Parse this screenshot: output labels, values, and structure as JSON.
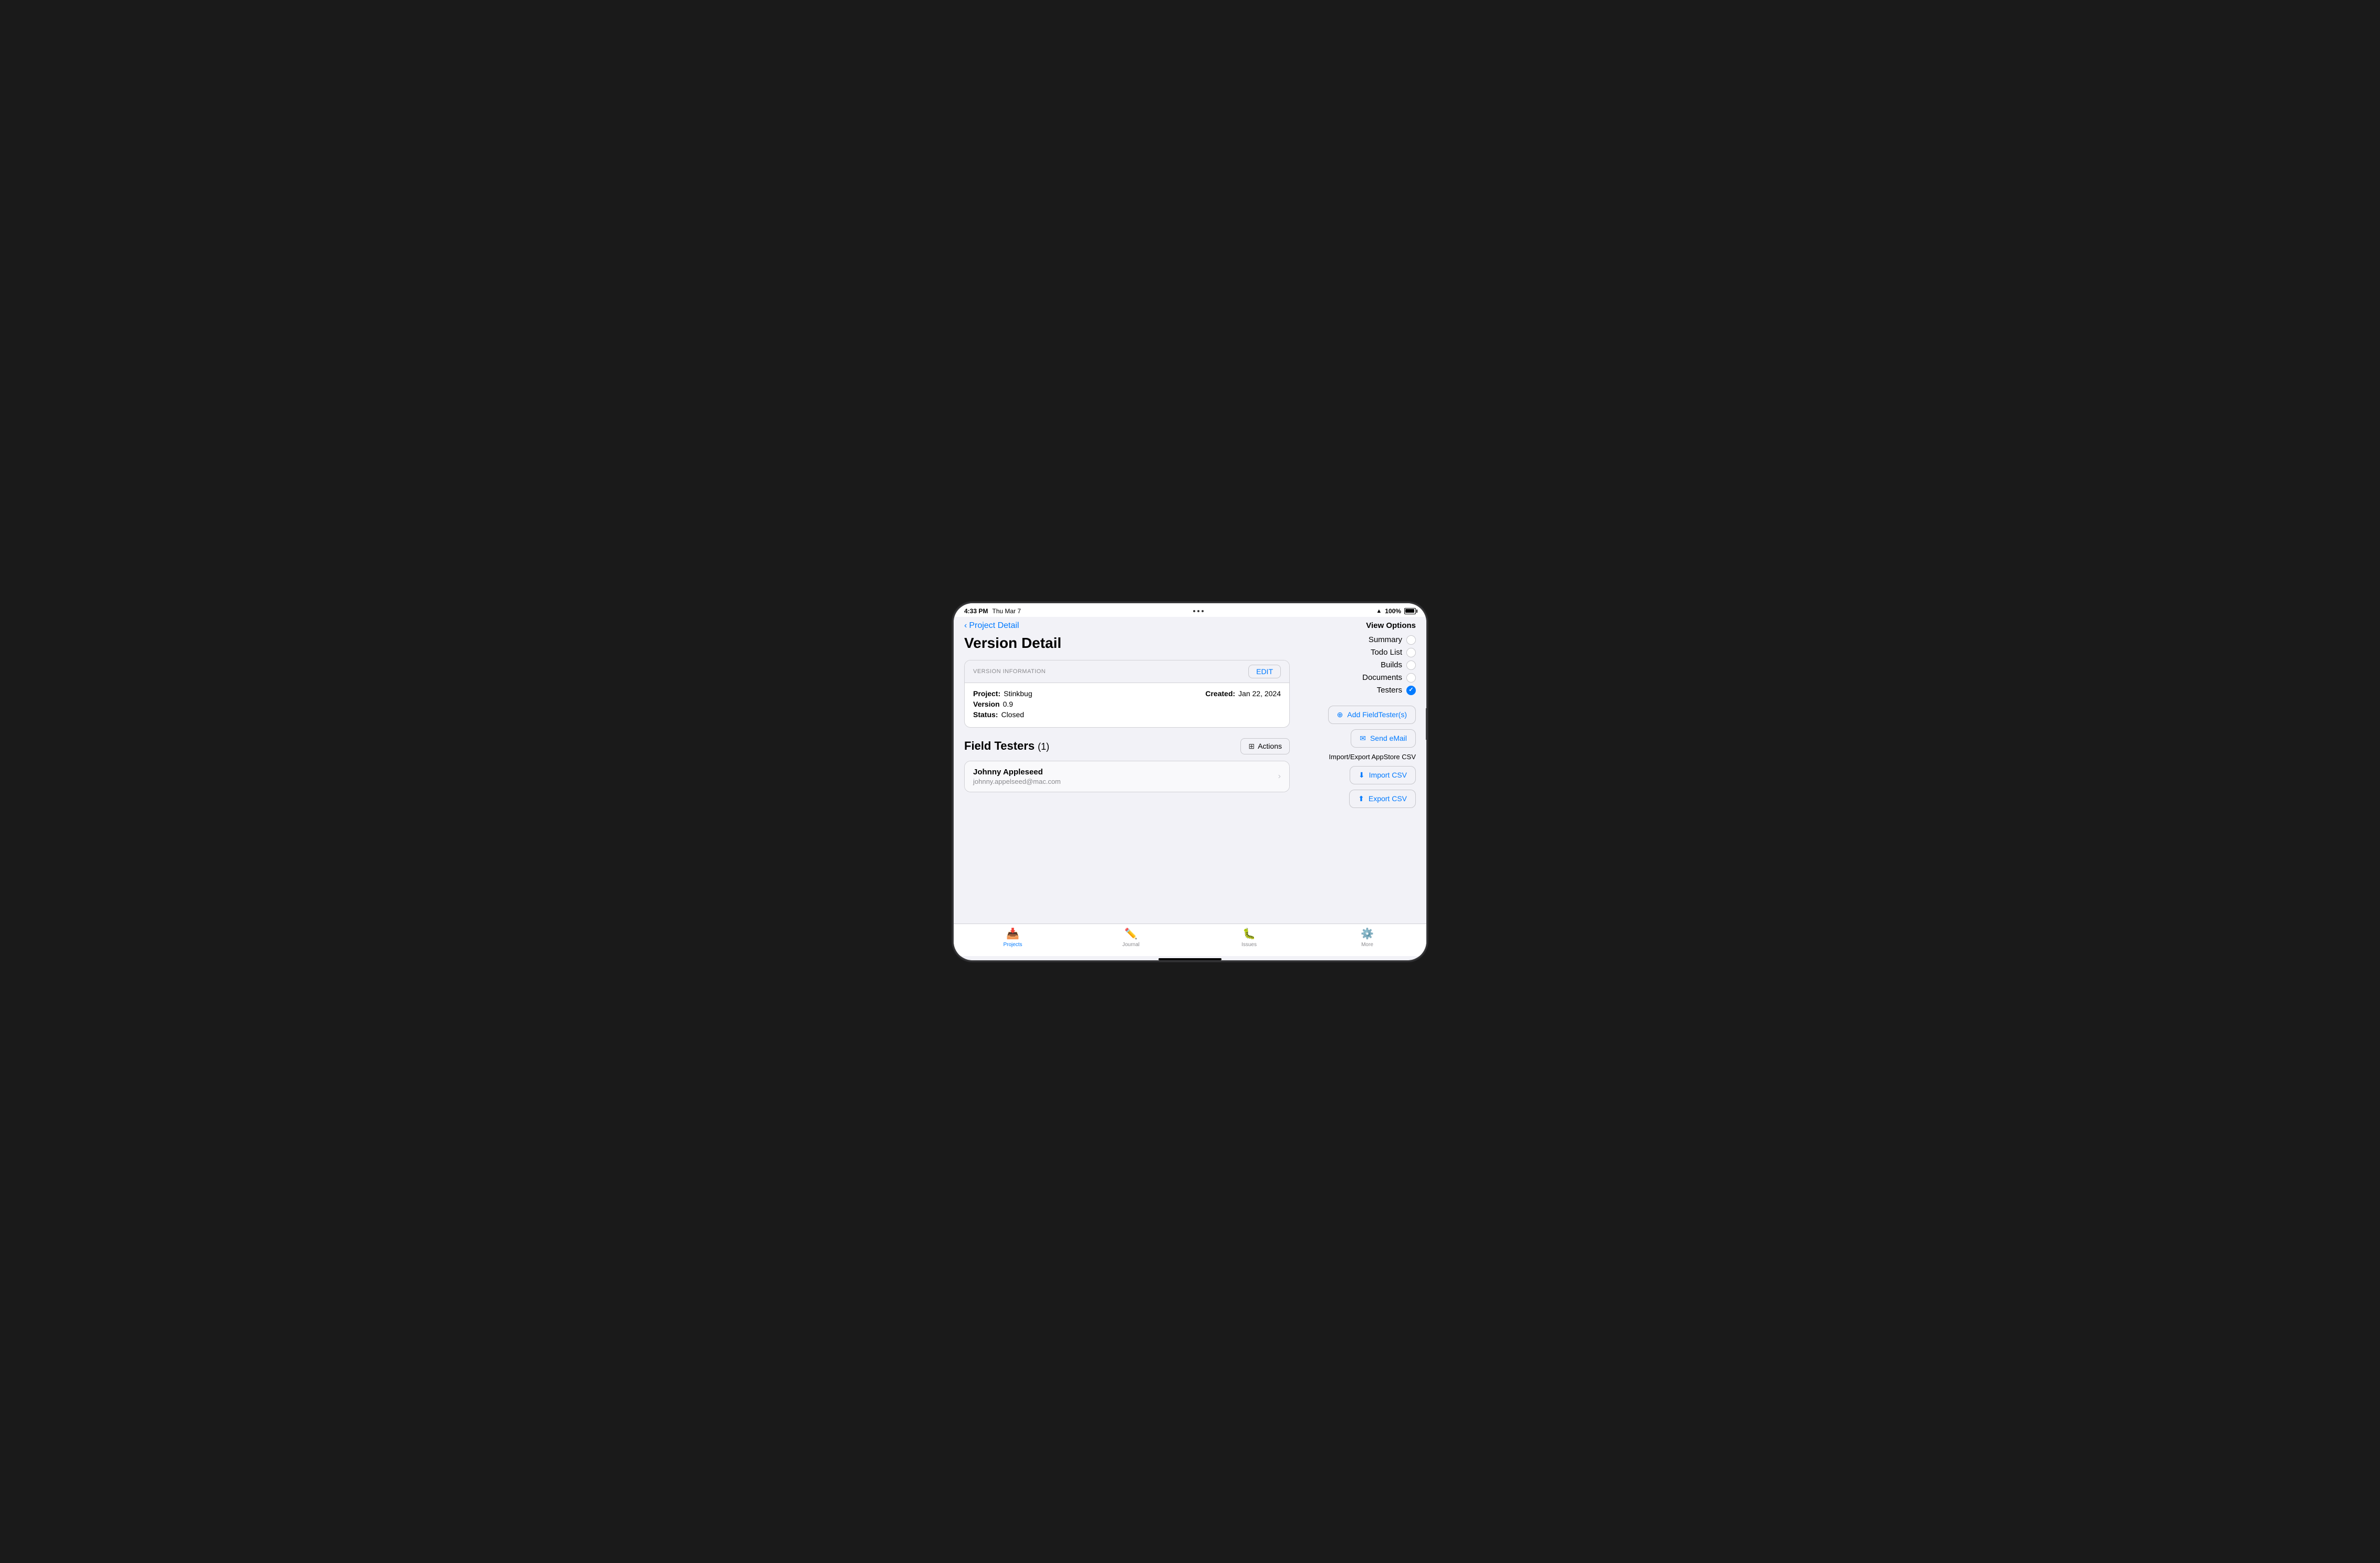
{
  "device": {
    "time": "4:33 PM",
    "date": "Thu Mar 7",
    "battery_pct": "100%",
    "wifi": "WiFi"
  },
  "nav": {
    "back_label": "Project Detail"
  },
  "page": {
    "title": "Version Detail"
  },
  "version_info": {
    "section_label": "VERSION INFORMATION",
    "edit_label": "EDIT",
    "project_label": "Project:",
    "project_value": "Stinkbug",
    "version_label": "Version",
    "version_value": "0.9",
    "status_label": "Status:",
    "status_value": "Closed",
    "created_label": "Created:",
    "created_value": "Jan 22, 2024"
  },
  "field_testers": {
    "section_title": "Field Testers",
    "count": "(1)",
    "actions_label": "Actions",
    "testers": [
      {
        "name": "Johnny Appleseed",
        "email": "johnny.appelseed@mac.com"
      }
    ]
  },
  "view_options": {
    "title": "View Options",
    "items": [
      {
        "label": "Summary",
        "selected": false
      },
      {
        "label": "Todo List",
        "selected": false
      },
      {
        "label": "Builds",
        "selected": false
      },
      {
        "label": "Documents",
        "selected": false
      },
      {
        "label": "Testers",
        "selected": true
      }
    ]
  },
  "actions_panel": {
    "add_label": "Add FieldTester(s)",
    "email_label": "Send eMail",
    "import_export_title": "Import/Export AppStore CSV",
    "import_label": "Import CSV",
    "export_label": "Export CSV"
  },
  "tab_bar": {
    "items": [
      {
        "label": "Projects",
        "icon": "📥",
        "active": false
      },
      {
        "label": "Journal",
        "icon": "✏️",
        "active": false
      },
      {
        "label": "Issues",
        "icon": "🐛",
        "active": false
      },
      {
        "label": "More",
        "icon": "⚙️",
        "active": false
      }
    ]
  }
}
